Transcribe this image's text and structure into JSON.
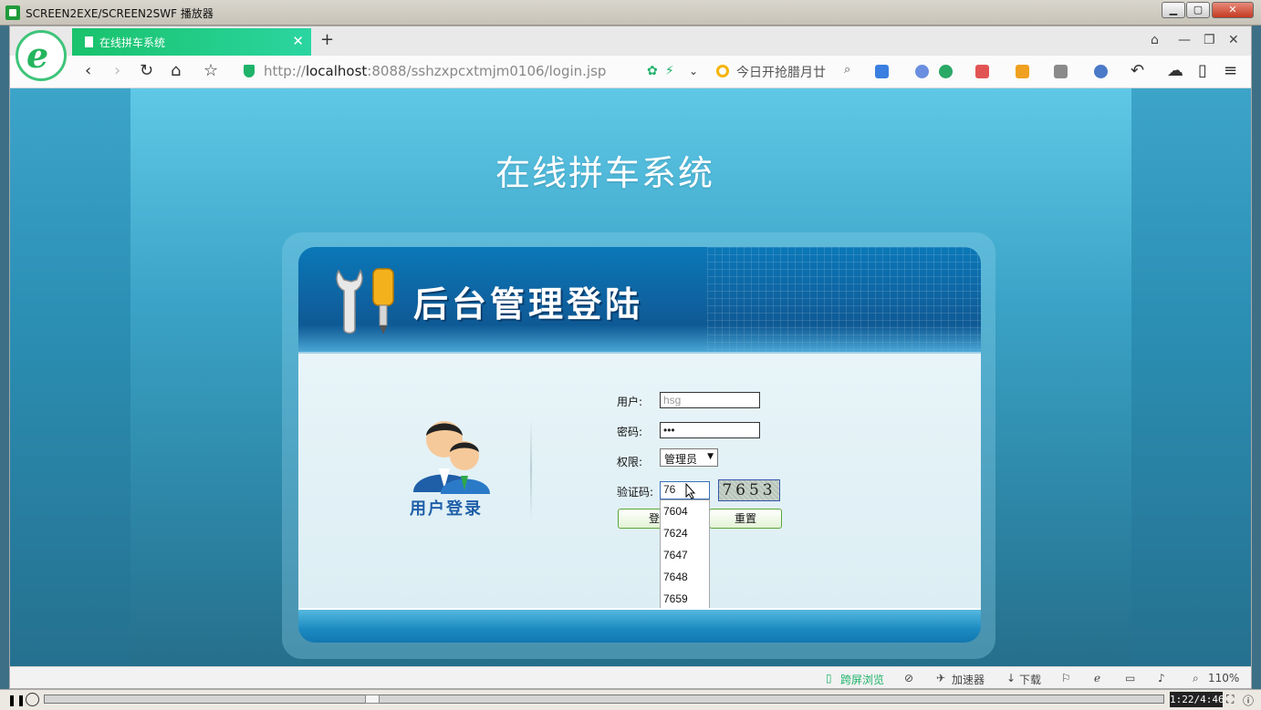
{
  "player": {
    "title": "SCREEN2EXE/SCREEN2SWF 播放器",
    "timer": "1:22/4:46",
    "progress_fraction": 0.29
  },
  "browser": {
    "tab_title": "在线拼车系统",
    "url_prefix": "http://",
    "url_host": "localhost",
    "url_rest": ":8088/sshzxpcxtmjm0106/login.jsp",
    "search_text": "今日开抢腊月廿",
    "status": {
      "cross_screen": "跨屏浏览",
      "accelerator": "加速器",
      "download": "下载",
      "zoom": "110%"
    }
  },
  "page": {
    "site_title": "在线拼车系统",
    "banner_title": "后台管理登陆",
    "user_login_label": "用户登录",
    "form": {
      "username_label": "用户:",
      "username_value": "hsg",
      "password_label": "密码:",
      "password_value": "•••",
      "role_label": "权限:",
      "role_selected": "管理员",
      "captcha_label": "验证码:",
      "captcha_value": "76",
      "captcha_image_text": "7653",
      "login_button": "登",
      "reset_button": "重置"
    },
    "autocomplete_options": [
      "7604",
      "7624",
      "7647",
      "7648",
      "7659"
    ]
  },
  "colors": {
    "tab_accent": "#19c26b",
    "page_background": "#3aa2c6",
    "banner_blue": "#0f5f9c"
  }
}
